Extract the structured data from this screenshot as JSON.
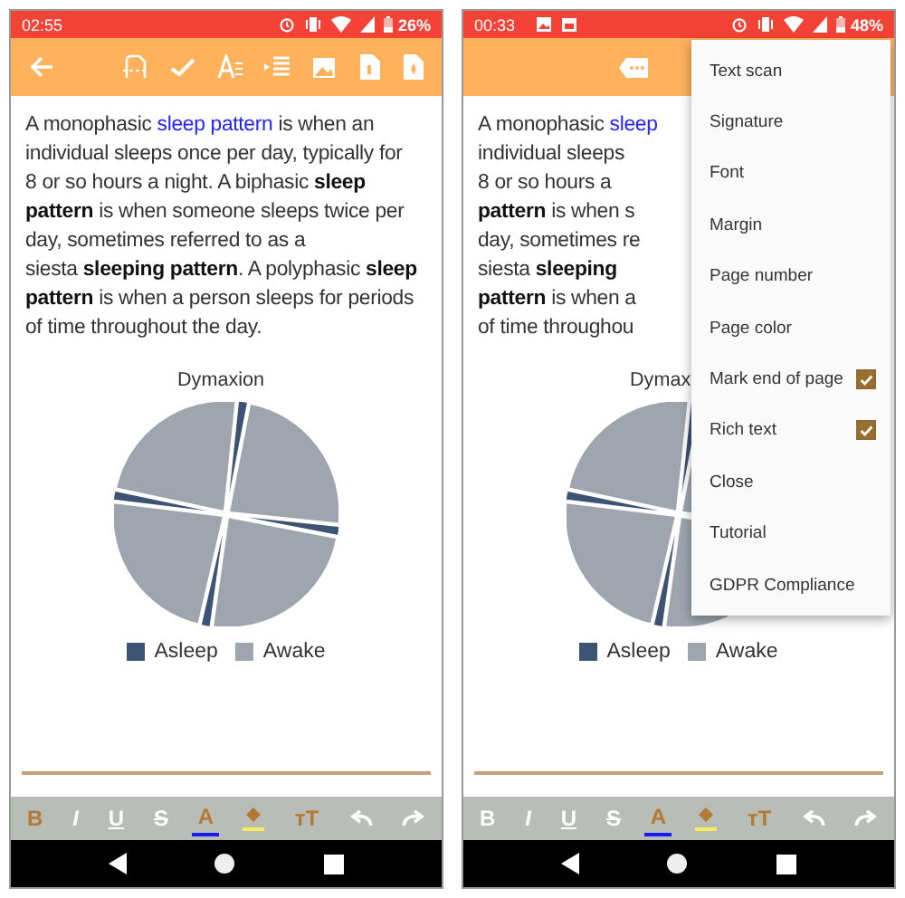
{
  "phones": [
    {
      "status_bar": {
        "time": "02:55",
        "battery": "26%",
        "notification_icons": false
      },
      "app_bar": {
        "kind": "editor"
      },
      "lines": [
        [
          {
            "text": "A monophasic ",
            "kind": "plain"
          },
          {
            "text": "sleep pattern",
            "kind": "link"
          },
          {
            "text": " is when an",
            "kind": "plain"
          }
        ],
        [
          {
            "text": "individual sleeps once per day, typically for",
            "kind": "plain"
          }
        ],
        [
          {
            "text": "8 or so hours a night. A biphasic ",
            "kind": "plain"
          },
          {
            "text": "sleep",
            "kind": "bold"
          }
        ],
        [
          {
            "text": "pattern",
            "kind": "bold"
          },
          {
            "text": " is when someone sleeps twice per",
            "kind": "plain"
          }
        ],
        [
          {
            "text": "day, sometimes referred to as a",
            "kind": "plain"
          }
        ],
        [
          {
            "text": "siesta ",
            "kind": "plain"
          },
          {
            "text": "sleeping pattern",
            "kind": "bold"
          },
          {
            "text": ". A polyphasic ",
            "kind": "plain"
          },
          {
            "text": "sleep",
            "kind": "bold"
          }
        ],
        [
          {
            "text": "pattern",
            "kind": "bold"
          },
          {
            "text": " is when a person sleeps for periods",
            "kind": "plain"
          }
        ],
        [
          {
            "text": "of time throughout the day.",
            "kind": "plain"
          }
        ]
      ],
      "chart_title": "Dymaxion",
      "legend": [
        {
          "label": "Asleep",
          "color": "#3d5373"
        },
        {
          "label": "Awake",
          "color": "#9ea5ae"
        }
      ],
      "format_buttons": [
        {
          "label": "B",
          "kind": "bold",
          "active": true
        },
        {
          "label": "I",
          "kind": "italic",
          "active": false
        },
        {
          "label": "U",
          "kind": "underline",
          "active": false
        },
        {
          "label": "S",
          "kind": "strike",
          "active": false
        },
        {
          "label": "A",
          "kind": "color",
          "active": true
        },
        {
          "kind": "fill",
          "active": true
        },
        {
          "label": "тT",
          "kind": "size",
          "active": true
        },
        {
          "kind": "undo",
          "active": false
        },
        {
          "kind": "redo",
          "active": false
        }
      ]
    },
    {
      "status_bar": {
        "time": "00:33",
        "battery": "48%",
        "notification_icons": true
      },
      "app_bar": {
        "kind": "menu_open"
      },
      "lines": [
        [
          {
            "text": "A monophasic ",
            "kind": "plain"
          },
          {
            "text": "sleep",
            "kind": "link"
          }
        ],
        [
          {
            "text": "individual sleeps",
            "kind": "plain"
          }
        ],
        [
          {
            "text": "8 or so hours a",
            "kind": "plain"
          }
        ],
        [
          {
            "text": "pattern",
            "kind": "bold"
          },
          {
            "text": " is when s",
            "kind": "plain"
          }
        ],
        [
          {
            "text": "day, sometimes re",
            "kind": "plain"
          }
        ],
        [
          {
            "text": "siesta ",
            "kind": "plain"
          },
          {
            "text": "sleeping",
            "kind": "bold"
          }
        ],
        [
          {
            "text": "pattern",
            "kind": "bold"
          },
          {
            "text": " is when a",
            "kind": "plain"
          }
        ],
        [
          {
            "text": "of time throughou",
            "kind": "plain"
          }
        ]
      ],
      "chart_title": "Dymax",
      "legend": [
        {
          "label": "Asleep",
          "color": "#3d5373"
        },
        {
          "label": "Awake",
          "color": "#9ea5ae"
        }
      ],
      "format_buttons": [
        {
          "label": "B",
          "kind": "bold",
          "active": false
        },
        {
          "label": "I",
          "kind": "italic",
          "active": false
        },
        {
          "label": "U",
          "kind": "underline",
          "active": false
        },
        {
          "label": "S",
          "kind": "strike",
          "active": false
        },
        {
          "label": "A",
          "kind": "color",
          "active": true
        },
        {
          "kind": "fill",
          "active": true
        },
        {
          "label": "тT",
          "kind": "size",
          "active": true
        },
        {
          "kind": "undo",
          "active": false
        },
        {
          "kind": "redo",
          "active": false
        }
      ]
    }
  ],
  "menu": {
    "items": [
      {
        "label": "Text scan",
        "kind": "plain"
      },
      {
        "label": "Signature",
        "kind": "plain"
      },
      {
        "label": "Font",
        "kind": "plain"
      },
      {
        "label": "Margin",
        "kind": "plain"
      },
      {
        "label": "Page number",
        "kind": "plain"
      },
      {
        "label": "Page color",
        "kind": "plain"
      },
      {
        "label": "Mark end of page",
        "kind": "checkbox",
        "checked": true
      },
      {
        "label": "Rich text",
        "kind": "checkbox",
        "checked": true
      },
      {
        "label": "Close",
        "kind": "plain"
      },
      {
        "label": "Tutorial",
        "kind": "plain"
      },
      {
        "label": "GDPR Compliance",
        "kind": "plain"
      }
    ]
  }
}
